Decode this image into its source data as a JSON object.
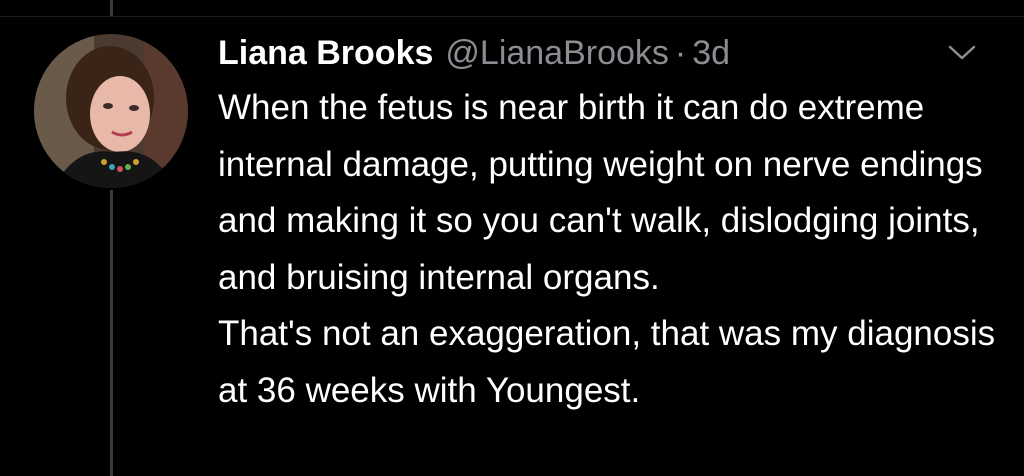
{
  "tweet": {
    "display_name": "Liana Brooks",
    "handle": "@LianaBrooks",
    "separator": "·",
    "timestamp": "3d",
    "paragraphs": [
      "When the fetus is near birth it can do extreme internal damage, putting weight on nerve endings and making it so you can't walk, dislodging joints, and bruising internal organs.",
      "That's not an exaggeration, that was my diagnosis at 36 weeks with Youngest."
    ]
  },
  "icons": {
    "avatar": "avatar-photo",
    "more": "chevron-down-icon"
  },
  "colors": {
    "background": "#000000",
    "text": "#ffffff",
    "secondary_text": "#8a8d91",
    "thread_line": "#3a3a3a"
  }
}
